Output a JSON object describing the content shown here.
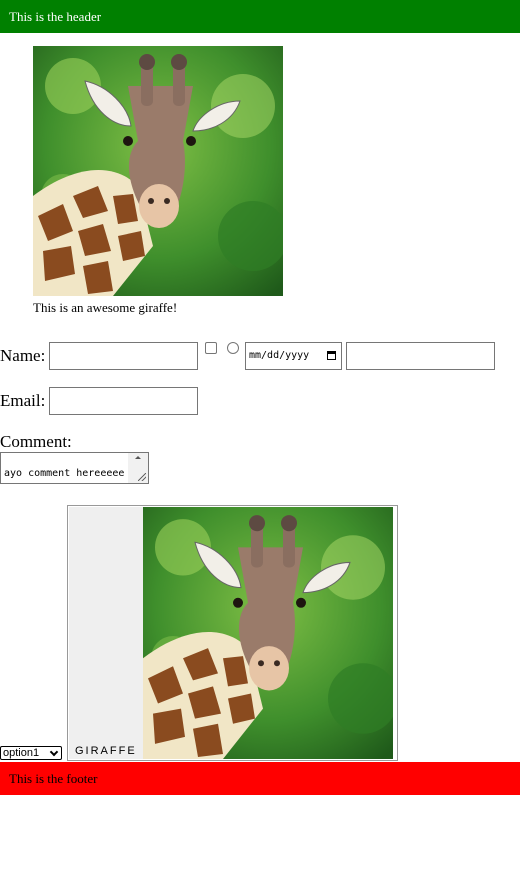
{
  "header": {
    "text": "This is the header"
  },
  "figure": {
    "image_subject": "giraffe",
    "caption": "This is an awesome giraffe!"
  },
  "form": {
    "name_label": "Name:",
    "name_value": "",
    "checkbox_checked": false,
    "radio_checked": false,
    "date_placeholder": "mm/dd/yyyy",
    "extra_value": "",
    "email_label": "Email:",
    "email_value": "",
    "comment_label": "Comment:",
    "comment_value": "ayo comment hereeeee"
  },
  "select": {
    "selected": "option1"
  },
  "fieldset": {
    "legend": "GIRAFFE",
    "image_subject": "giraffe"
  },
  "footer": {
    "text": "This is the footer"
  },
  "colors": {
    "header_bg": "#008000",
    "footer_bg": "#ff0000"
  }
}
